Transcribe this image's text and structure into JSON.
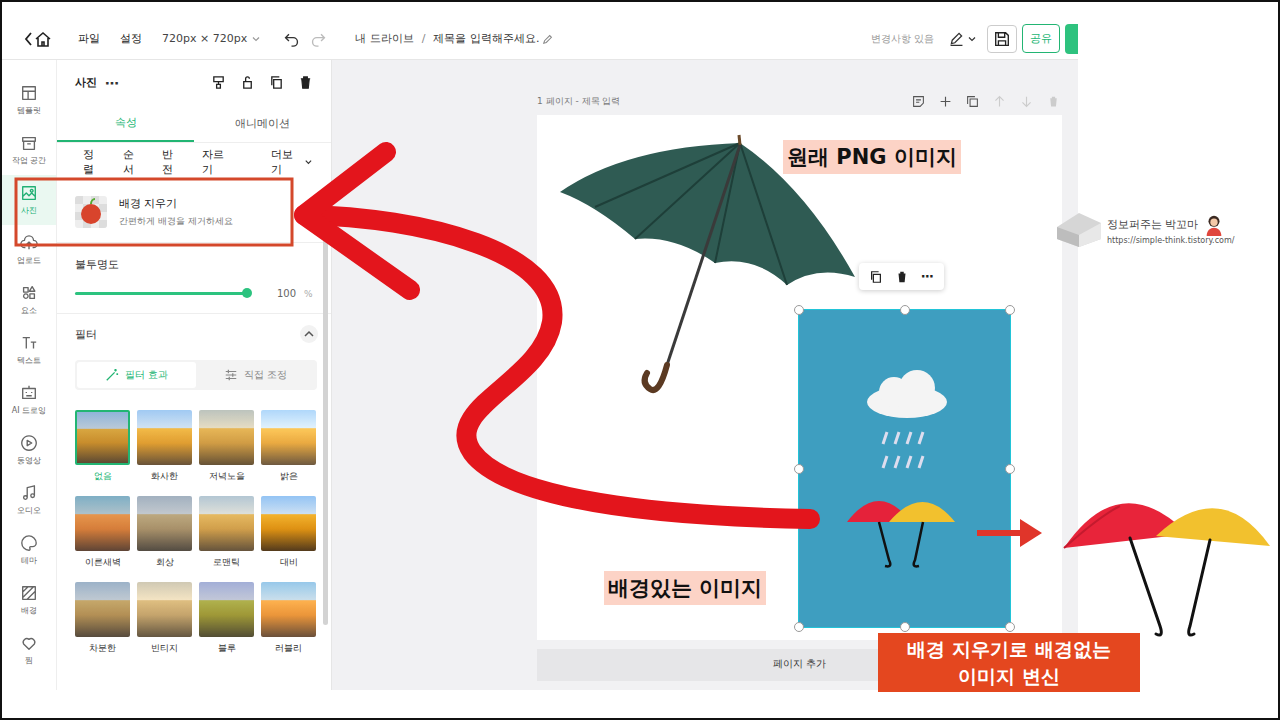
{
  "topbar": {
    "menu": [
      "파일",
      "설정"
    ],
    "size": "720px × 720px",
    "breadcrumb": {
      "root": "내 드라이브",
      "separator": "/",
      "title": "제목을 입력해주세요."
    },
    "status": "변경사항 있음",
    "share": "공유"
  },
  "rail": [
    {
      "label": "템플릿",
      "selected": false
    },
    {
      "label": "작업 공간",
      "selected": false
    },
    {
      "label": "사진",
      "selected": true
    },
    {
      "label": "업로드",
      "selected": false
    },
    {
      "label": "요소",
      "selected": false
    },
    {
      "label": "텍스트",
      "selected": false
    },
    {
      "label": "AI 드로잉",
      "selected": false
    },
    {
      "label": "동영상",
      "selected": false
    },
    {
      "label": "오디오",
      "selected": false
    },
    {
      "label": "테마",
      "selected": false
    },
    {
      "label": "배경",
      "selected": false
    },
    {
      "label": "찜",
      "selected": false
    }
  ],
  "panel": {
    "title": "사진",
    "more": "⋯",
    "tabs": [
      {
        "label": "속성",
        "selected": true
      },
      {
        "label": "애니메이션",
        "selected": false
      }
    ],
    "tools": [
      "정렬",
      "순서",
      "반전",
      "자르기"
    ],
    "tools_more": "더보기",
    "bg_remove": {
      "title": "배경 지우기",
      "desc": "간편하게 배경을 제거하세요"
    },
    "opacity": {
      "label": "불투명도",
      "level": 1,
      "reading": "100",
      "unit": "%"
    },
    "filter": {
      "label": "필터",
      "expanded": true,
      "modes": [
        {
          "label": "필터 효과",
          "selected": true
        },
        {
          "label": "직접 조정",
          "selected": false
        }
      ],
      "items": [
        {
          "label": "없음",
          "selected": true
        },
        {
          "label": "화사한",
          "selected": false
        },
        {
          "label": "저녁노을",
          "selected": false
        },
        {
          "label": "밝은",
          "selected": false
        },
        {
          "label": "이른새벽",
          "selected": false
        },
        {
          "label": "회상",
          "selected": false
        },
        {
          "label": "로맨틱",
          "selected": false
        },
        {
          "label": "대비",
          "selected": false
        },
        {
          "label": "차분한",
          "selected": false
        },
        {
          "label": "빈티지",
          "selected": false
        },
        {
          "label": "블루",
          "selected": false
        },
        {
          "label": "러블리",
          "selected": false
        }
      ]
    }
  },
  "canvas": {
    "page_label": "1 페이지 - 제목 입력",
    "add_page": "페이지 추가",
    "photo": {
      "selected": true,
      "toolbar_more": "⋯"
    }
  },
  "annotations": {
    "png_label": "원래 PNG 이미지",
    "bg_label": "배경있는 이미지",
    "result_label": [
      "배경 지우기로 배경없는",
      "이미지 변신"
    ]
  },
  "watermark": {
    "name": "정보퍼주는 박꼬마",
    "url": "https://simple-think.tistory.com/"
  }
}
